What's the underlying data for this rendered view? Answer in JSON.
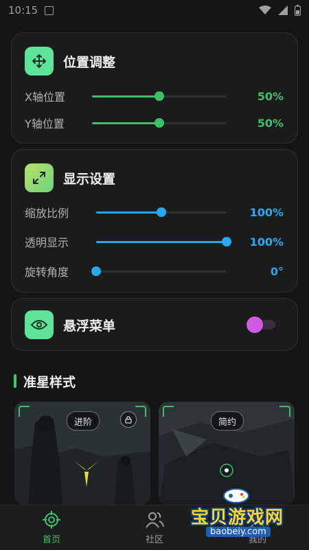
{
  "status_bar": {
    "time": "10:15"
  },
  "position_card": {
    "title": "位置调整",
    "icon": "move-arrows-icon",
    "accent": "#3fbf6e",
    "rows": [
      {
        "label": "X轴位置",
        "value": 50,
        "display": "50%"
      },
      {
        "label": "Y轴位置",
        "value": 50,
        "display": "50%"
      }
    ]
  },
  "display_card": {
    "title": "显示设置",
    "icon": "expand-arrows-icon",
    "accent": "#27a8f0",
    "rows": [
      {
        "label": "缩放比例",
        "value": 50,
        "display": "100%"
      },
      {
        "label": "透明显示",
        "value": 100,
        "display": "100%"
      },
      {
        "label": "旋转角度",
        "value": 0,
        "display": "0°"
      }
    ]
  },
  "float_card": {
    "title": "悬浮菜单",
    "icon": "eye-icon",
    "toggle_on": true,
    "toggle_color": "#d05ae0"
  },
  "crosshair_section": {
    "title": "准星样式",
    "previews": [
      {
        "tag": "进阶",
        "locked": true
      },
      {
        "tag": "简约",
        "locked": false
      }
    ]
  },
  "tabbar": {
    "tabs": [
      {
        "label": "首页",
        "icon": "crosshair-target-icon",
        "active": true
      },
      {
        "label": "社区",
        "icon": "users-icon",
        "active": false
      },
      {
        "label": "我的",
        "icon": "person-icon",
        "active": false
      }
    ],
    "active_color": "#3fbf6e"
  },
  "watermark": {
    "title": "宝贝游戏网",
    "url": "baobeiy.com"
  }
}
